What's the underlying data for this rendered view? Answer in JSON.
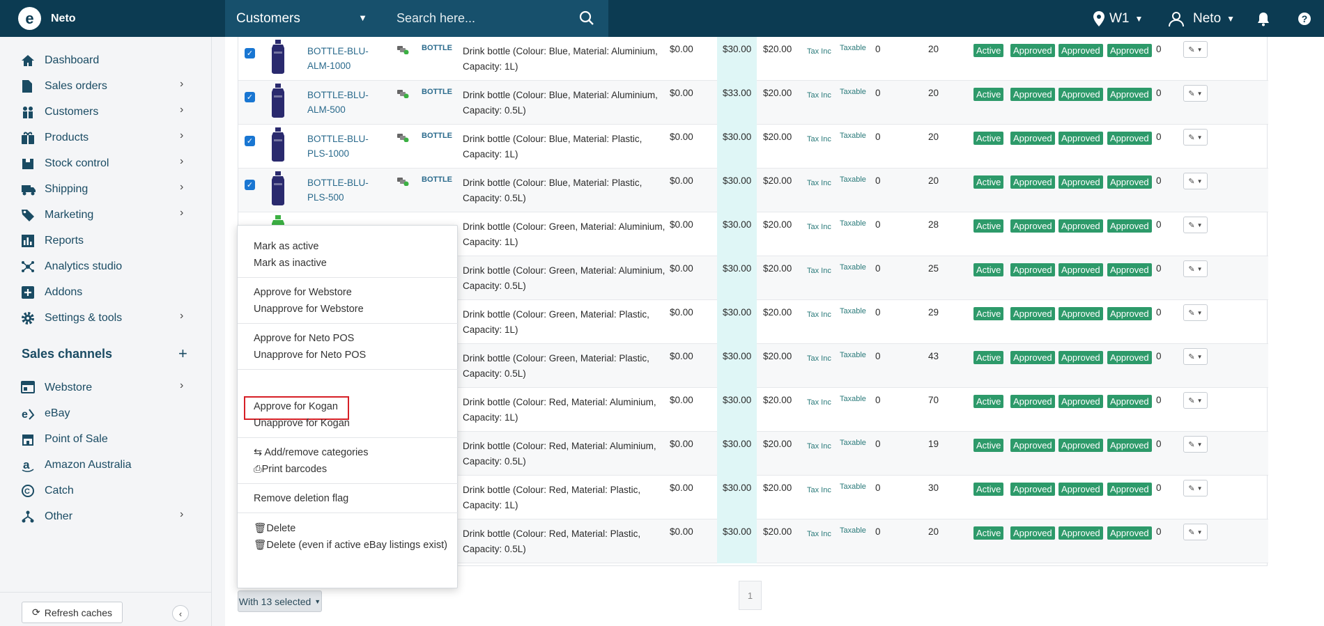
{
  "topbar": {
    "brand": "Neto",
    "section": "Customers",
    "search_placeholder": "Search here...",
    "location": "W1",
    "user": "Neto"
  },
  "sidebar": {
    "items": [
      {
        "label": "Dashboard",
        "icon": "home-icon",
        "chevron": false
      },
      {
        "label": "Sales orders",
        "icon": "document-icon",
        "chevron": true
      },
      {
        "label": "Customers",
        "icon": "users-icon",
        "chevron": true
      },
      {
        "label": "Products",
        "icon": "gift-icon",
        "chevron": true
      },
      {
        "label": "Stock control",
        "icon": "box-icon",
        "chevron": true
      },
      {
        "label": "Shipping",
        "icon": "truck-icon",
        "chevron": true
      },
      {
        "label": "Marketing",
        "icon": "tag-icon",
        "chevron": true
      },
      {
        "label": "Reports",
        "icon": "bar-chart-icon",
        "chevron": false
      },
      {
        "label": "Analytics studio",
        "icon": "analytics-icon",
        "chevron": false
      },
      {
        "label": "Addons",
        "icon": "plus-square-icon",
        "chevron": false
      },
      {
        "label": "Settings & tools",
        "icon": "gear-icon",
        "chevron": true
      }
    ],
    "sales_channels_title": "Sales channels",
    "channels": [
      {
        "label": "Webstore",
        "icon": "webstore-icon",
        "chevron": true
      },
      {
        "label": "eBay",
        "icon": "ebay-icon",
        "chevron": false
      },
      {
        "label": "Point of Sale",
        "icon": "store-icon",
        "chevron": false
      },
      {
        "label": "Amazon Australia",
        "icon": "amazon-icon",
        "chevron": false
      },
      {
        "label": "Catch",
        "icon": "catch-icon",
        "chevron": false
      },
      {
        "label": "Other",
        "icon": "sitemap-icon",
        "chevron": true
      }
    ],
    "refresh_label": "Refresh caches"
  },
  "rows": [
    {
      "sku": "BOTTLE-BLU-ALM-1000",
      "tag": "BOTTLE",
      "name": "Drink bottle (Colour: Blue, Material: Aluminium, Capacity: 1L)",
      "p1": "$0.00",
      "p2": "$30.00",
      "p3": "$20.00",
      "tax": "Tax Inc",
      "taxable": "Taxable",
      "q1": "0",
      "q2": "20",
      "q3": "0",
      "color": "#2a2a6e",
      "checked": true
    },
    {
      "sku": "BOTTLE-BLU-ALM-500",
      "tag": "BOTTLE",
      "name": "Drink bottle (Colour: Blue, Material: Aluminium, Capacity: 0.5L)",
      "p1": "$0.00",
      "p2": "$33.00",
      "p3": "$20.00",
      "tax": "Tax Inc",
      "taxable": "Taxable",
      "q1": "0",
      "q2": "20",
      "q3": "0",
      "color": "#2a2a6e",
      "checked": true
    },
    {
      "sku": "BOTTLE-BLU-PLS-1000",
      "tag": "BOTTLE",
      "name": "Drink bottle (Colour: Blue, Material: Plastic, Capacity: 1L)",
      "p1": "$0.00",
      "p2": "$30.00",
      "p3": "$20.00",
      "tax": "Tax Inc",
      "taxable": "Taxable",
      "q1": "0",
      "q2": "20",
      "q3": "0",
      "color": "#2a2a6e",
      "checked": true
    },
    {
      "sku": "BOTTLE-BLU-PLS-500",
      "tag": "BOTTLE",
      "name": "Drink bottle (Colour: Blue, Material: Plastic, Capacity: 0.5L)",
      "p1": "$0.00",
      "p2": "$30.00",
      "p3": "$20.00",
      "tax": "Tax Inc",
      "taxable": "Taxable",
      "q1": "0",
      "q2": "20",
      "q3": "0",
      "color": "#2a2a6e",
      "checked": true
    },
    {
      "sku": "",
      "tag": "",
      "name": "Drink bottle (Colour: Green, Material: Aluminium, Capacity: 1L)",
      "p1": "$0.00",
      "p2": "$30.00",
      "p3": "$20.00",
      "tax": "Tax Inc",
      "taxable": "Taxable",
      "q1": "0",
      "q2": "28",
      "q3": "0",
      "color": "#3cb043",
      "checked": false
    },
    {
      "sku": "",
      "tag": "",
      "name": "Drink bottle (Colour: Green, Material: Aluminium, Capacity: 0.5L)",
      "p1": "$0.00",
      "p2": "$30.00",
      "p3": "$20.00",
      "tax": "Tax Inc",
      "taxable": "Taxable",
      "q1": "0",
      "q2": "25",
      "q3": "0",
      "color": "",
      "checked": false
    },
    {
      "sku": "",
      "tag": "",
      "name": "Drink bottle (Colour: Green, Material: Plastic, Capacity: 1L)",
      "p1": "$0.00",
      "p2": "$30.00",
      "p3": "$20.00",
      "tax": "Tax Inc",
      "taxable": "Taxable",
      "q1": "0",
      "q2": "29",
      "q3": "0",
      "color": "",
      "checked": false
    },
    {
      "sku": "",
      "tag": "",
      "name": "Drink bottle (Colour: Green, Material: Plastic, Capacity: 0.5L)",
      "p1": "$0.00",
      "p2": "$30.00",
      "p3": "$20.00",
      "tax": "Tax Inc",
      "taxable": "Taxable",
      "q1": "0",
      "q2": "43",
      "q3": "0",
      "color": "",
      "checked": false
    },
    {
      "sku": "",
      "tag": "",
      "name": "Drink bottle (Colour: Red, Material: Aluminium, Capacity: 1L)",
      "p1": "$0.00",
      "p2": "$30.00",
      "p3": "$20.00",
      "tax": "Tax Inc",
      "taxable": "Taxable",
      "q1": "0",
      "q2": "70",
      "q3": "0",
      "color": "",
      "checked": false
    },
    {
      "sku": "",
      "tag": "",
      "name": "Drink bottle (Colour: Red, Material: Aluminium, Capacity: 0.5L)",
      "p1": "$0.00",
      "p2": "$30.00",
      "p3": "$20.00",
      "tax": "Tax Inc",
      "taxable": "Taxable",
      "q1": "0",
      "q2": "19",
      "q3": "0",
      "color": "",
      "checked": false
    },
    {
      "sku": "",
      "tag": "",
      "name": "Drink bottle (Colour: Red, Material: Plastic, Capacity: 1L)",
      "p1": "$0.00",
      "p2": "$30.00",
      "p3": "$20.00",
      "tax": "Tax Inc",
      "taxable": "Taxable",
      "q1": "0",
      "q2": "30",
      "q3": "0",
      "color": "",
      "checked": false
    },
    {
      "sku": "",
      "tag": "",
      "name": "Drink bottle (Colour: Red, Material: Plastic, Capacity: 0.5L)",
      "p1": "$0.00",
      "p2": "$30.00",
      "p3": "$20.00",
      "tax": "Tax Inc",
      "taxable": "Taxable",
      "q1": "0",
      "q2": "20",
      "q3": "0",
      "color": "",
      "checked": false
    }
  ],
  "badges": {
    "status": "Active",
    "approved": "Approved"
  },
  "colors": {
    "accent": "#0c3b52",
    "badge": "#2d9a6a",
    "price_highlight": "#dff6f6",
    "selection_box": "#d61f26"
  },
  "pager": {
    "page": "1"
  },
  "bulk_button": "With 13 selected",
  "menu": {
    "mark_active": "Mark as active",
    "mark_inactive": "Mark as inactive",
    "approve_webstore": "Approve for Webstore",
    "unapprove_webstore": "Unapprove for Webstore",
    "approve_pos": "Approve for Neto POS",
    "unapprove_pos": "Unapprove for Neto POS",
    "approve_kogan": "Approve for Kogan",
    "unapprove_kogan": "Unapprove for Kogan",
    "categories": "Add/remove categories",
    "barcodes": "Print barcodes",
    "remove_deletion": "Remove deletion flag",
    "delete": "Delete",
    "delete_force": "Delete (even if active eBay listings exist)"
  }
}
